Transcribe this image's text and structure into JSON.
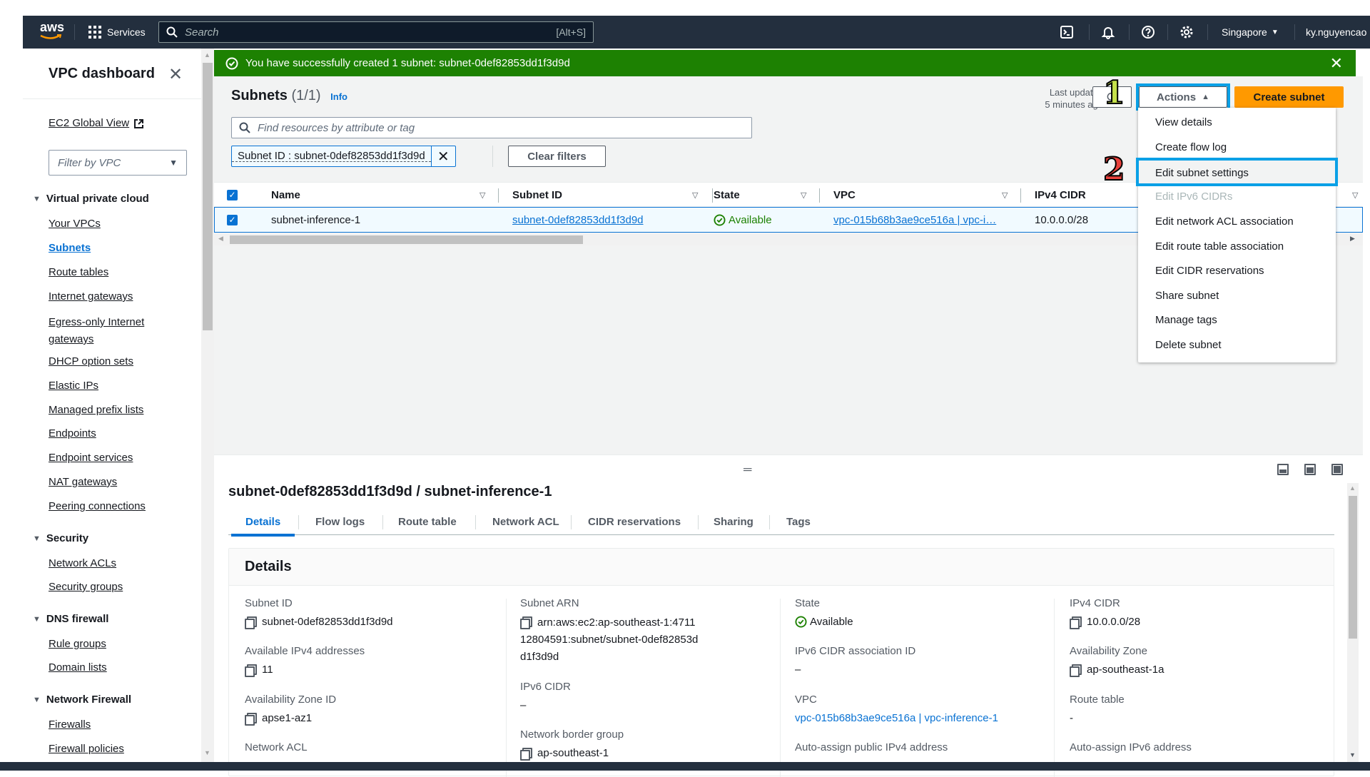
{
  "topnav": {
    "logo": "aws",
    "services_label": "Services",
    "search_placeholder": "Search",
    "search_shortcut": "[Alt+S]",
    "icons": [
      "cloudshell-icon",
      "bell-icon",
      "help-icon",
      "gear-icon"
    ],
    "region": "Singapore",
    "user": "ky.nguyencao"
  },
  "sidebar": {
    "title": "VPC dashboard",
    "ec2_global_view": "EC2 Global View",
    "filter_placeholder": "Filter by VPC",
    "sections": [
      {
        "label": "Virtual private cloud",
        "items": [
          "Your VPCs",
          "Subnets",
          "Route tables",
          "Internet gateways",
          "Egress-only Internet gateways",
          "DHCP option sets",
          "Elastic IPs",
          "Managed prefix lists",
          "Endpoints",
          "Endpoint services",
          "NAT gateways",
          "Peering connections"
        ]
      },
      {
        "label": "Security",
        "items": [
          "Network ACLs",
          "Security groups"
        ]
      },
      {
        "label": "DNS firewall",
        "items": [
          "Rule groups",
          "Domain lists"
        ]
      },
      {
        "label": "Network Firewall",
        "items": [
          "Firewalls",
          "Firewall policies"
        ]
      }
    ],
    "active_item": "Subnets"
  },
  "banner": {
    "message": "You have successfully created 1 subnet: subnet-0def82853dd1f3d9d",
    "color": "#1d8102"
  },
  "subnets": {
    "title": "Subnets",
    "count": "(1/1)",
    "info": "Info",
    "last_updated_line1": "Last updated",
    "last_updated_line2": "5 minutes ago",
    "actions_label": "Actions",
    "create_label": "Create subnet",
    "search_placeholder": "Find resources by attribute or tag",
    "filter_token": "Subnet ID : subnet-0def82853dd1f3d9d",
    "clear_filters": "Clear filters",
    "columns": [
      "Name",
      "Subnet ID",
      "State",
      "VPC",
      "IPv4 CIDR"
    ],
    "rows": [
      {
        "name": "subnet-inference-1",
        "subnet_id": "subnet-0def82853dd1f3d9d",
        "state": "Available",
        "vpc": "vpc-015b68b3ae9ce516a | vpc-i…",
        "ipv4_cidr": "10.0.0.0/28",
        "selected": true
      }
    ]
  },
  "actions_menu": {
    "items": [
      {
        "label": "View details",
        "disabled": false
      },
      {
        "label": "Create flow log",
        "disabled": false
      },
      {
        "label": "Edit subnet settings",
        "disabled": false,
        "hovered": true
      },
      {
        "label": "Edit IPv6 CIDRs",
        "disabled": true
      },
      {
        "label": "Edit network ACL association",
        "disabled": false
      },
      {
        "label": "Edit route table association",
        "disabled": false
      },
      {
        "label": "Edit CIDR reservations",
        "disabled": false
      },
      {
        "label": "Share subnet",
        "disabled": false
      },
      {
        "label": "Manage tags",
        "disabled": false
      },
      {
        "label": "Delete subnet",
        "disabled": false
      }
    ]
  },
  "annotations": {
    "step1": "1",
    "step2": "2",
    "step1_color": "#c5e04a",
    "step2_color": "#e8413c",
    "highlight_color": "#0aa0e6"
  },
  "detail": {
    "title": "subnet-0def82853dd1f3d9d / subnet-inference-1",
    "tabs": [
      "Details",
      "Flow logs",
      "Route table",
      "Network ACL",
      "CIDR reservations",
      "Sharing",
      "Tags"
    ],
    "active_tab": "Details",
    "card_title": "Details",
    "fields": {
      "subnet_id": {
        "label": "Subnet ID",
        "value": "subnet-0def82853dd1f3d9d"
      },
      "available_ipv4": {
        "label": "Available IPv4 addresses",
        "value": "11"
      },
      "az_id": {
        "label": "Availability Zone ID",
        "value": "apse1-az1"
      },
      "network_acl": {
        "label": "Network ACL"
      },
      "subnet_arn": {
        "label": "Subnet ARN",
        "value": "arn:aws:ec2:ap-southeast-1:471112804591:subnet/subnet-0def82853dd1f3d9d"
      },
      "ipv6_cidr": {
        "label": "IPv6 CIDR",
        "value": "–"
      },
      "network_border_group": {
        "label": "Network border group",
        "value": "ap-southeast-1"
      },
      "state": {
        "label": "State",
        "value": "Available"
      },
      "ipv6_assoc": {
        "label": "IPv6 CIDR association ID",
        "value": "–"
      },
      "vpc": {
        "label": "VPC",
        "value": "vpc-015b68b3ae9ce516a | vpc-inference-1"
      },
      "auto_ipv4": {
        "label": "Auto-assign public IPv4 address"
      },
      "ipv4_cidr": {
        "label": "IPv4 CIDR",
        "value": "10.0.0.0/28"
      },
      "az": {
        "label": "Availability Zone",
        "value": "ap-southeast-1a"
      },
      "route_table": {
        "label": "Route table",
        "value": "-"
      },
      "auto_ipv6": {
        "label": "Auto-assign IPv6 address"
      }
    }
  }
}
